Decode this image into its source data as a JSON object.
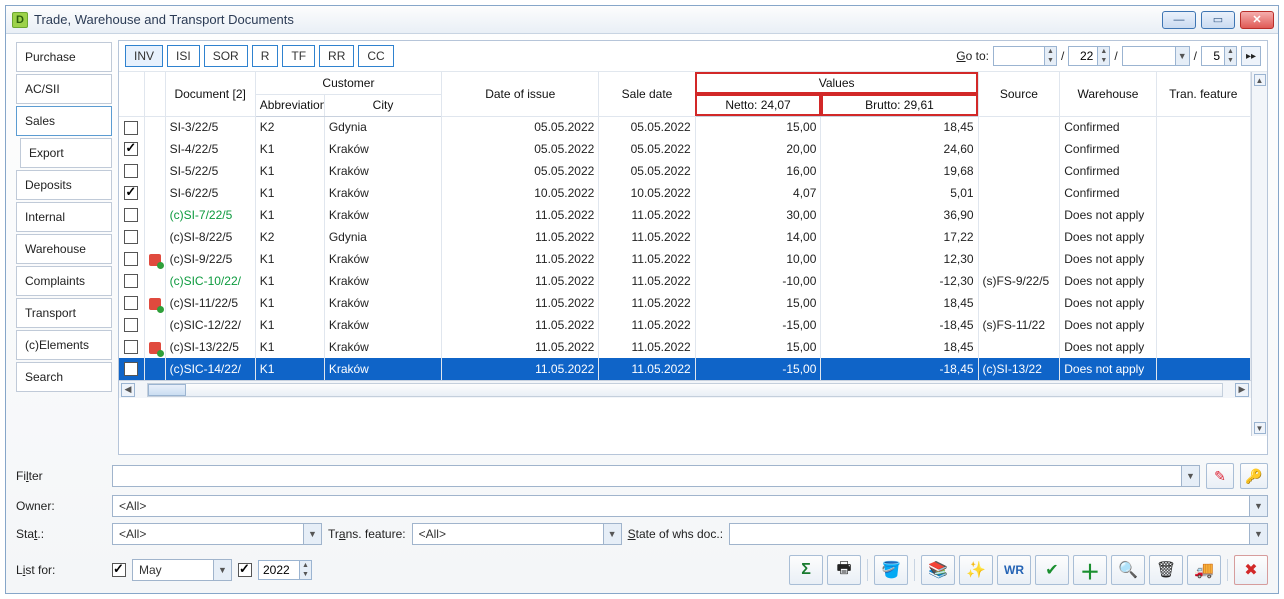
{
  "window": {
    "title": "Trade, Warehouse and Transport Documents"
  },
  "vtabs": {
    "purchase": "Purchase",
    "acsii": "AC/SII",
    "sales": "Sales",
    "export": "Export",
    "deposits": "Deposits",
    "internal": "Internal",
    "warehouse": "Warehouse",
    "complaints": "Complaints",
    "transport": "Transport",
    "celements": "(c)Elements",
    "search": "Search"
  },
  "doctabs": {
    "inv": "INV",
    "isi": "ISI",
    "sor": "SOR",
    "r": "R",
    "tf": "TF",
    "rr": "RR",
    "cc": "CC"
  },
  "goto": {
    "label": "Go to:",
    "val1": "",
    "slash": "/",
    "val2": "22",
    "val3": "",
    "val4": "5"
  },
  "grid": {
    "headers": {
      "document": "Document [2]",
      "customer": "Customer",
      "abbr": "Abbreviation",
      "city": "City",
      "dateissue": "Date of issue",
      "saledate": "Sale date",
      "values": "Values",
      "netto": "Netto: 24,07",
      "brutto": "Brutto: 29,61",
      "source": "Source",
      "warehouse": "Warehouse",
      "tranfeature": "Tran. feature"
    },
    "rows": [
      {
        "checked": false,
        "flag": "",
        "doc": "SI-3/22/5",
        "green": false,
        "abbr": "K2",
        "city": "Gdynia",
        "d1": "05.05.2022",
        "d2": "05.05.2022",
        "netto": "15,00",
        "brutto": "18,45",
        "src": "",
        "wh": "Confirmed",
        "tf": ""
      },
      {
        "checked": true,
        "flag": "",
        "doc": "SI-4/22/5",
        "green": false,
        "abbr": "K1",
        "city": "Kraków",
        "d1": "05.05.2022",
        "d2": "05.05.2022",
        "netto": "20,00",
        "brutto": "24,60",
        "src": "",
        "wh": "Confirmed",
        "tf": ""
      },
      {
        "checked": false,
        "flag": "",
        "doc": "SI-5/22/5",
        "green": false,
        "abbr": "K1",
        "city": "Kraków",
        "d1": "05.05.2022",
        "d2": "05.05.2022",
        "netto": "16,00",
        "brutto": "19,68",
        "src": "",
        "wh": "Confirmed",
        "tf": ""
      },
      {
        "checked": true,
        "flag": "",
        "doc": "SI-6/22/5",
        "green": false,
        "abbr": "K1",
        "city": "Kraków",
        "d1": "10.05.2022",
        "d2": "10.05.2022",
        "netto": "4,07",
        "brutto": "5,01",
        "src": "",
        "wh": "Confirmed",
        "tf": ""
      },
      {
        "checked": false,
        "flag": "",
        "doc": "(c)SI-7/22/5",
        "green": true,
        "abbr": "K1",
        "city": "Kraków",
        "d1": "11.05.2022",
        "d2": "11.05.2022",
        "netto": "30,00",
        "brutto": "36,90",
        "src": "",
        "wh": "Does not apply",
        "tf": ""
      },
      {
        "checked": false,
        "flag": "",
        "doc": "(c)SI-8/22/5",
        "green": false,
        "abbr": "K2",
        "city": "Gdynia",
        "d1": "11.05.2022",
        "d2": "11.05.2022",
        "netto": "14,00",
        "brutto": "17,22",
        "src": "",
        "wh": "Does not apply",
        "tf": ""
      },
      {
        "checked": false,
        "flag": "red",
        "doc": "(c)SI-9/22/5",
        "green": false,
        "abbr": "K1",
        "city": "Kraków",
        "d1": "11.05.2022",
        "d2": "11.05.2022",
        "netto": "10,00",
        "brutto": "12,30",
        "src": "",
        "wh": "Does not apply",
        "tf": ""
      },
      {
        "checked": false,
        "flag": "",
        "doc": "(c)SIC-10/22/",
        "green": true,
        "abbr": "K1",
        "city": "Kraków",
        "d1": "11.05.2022",
        "d2": "11.05.2022",
        "netto": "-10,00",
        "brutto": "-12,30",
        "src": "(s)FS-9/22/5",
        "wh": "Does not apply",
        "tf": ""
      },
      {
        "checked": false,
        "flag": "red",
        "doc": "(c)SI-11/22/5",
        "green": false,
        "abbr": "K1",
        "city": "Kraków",
        "d1": "11.05.2022",
        "d2": "11.05.2022",
        "netto": "15,00",
        "brutto": "18,45",
        "src": "",
        "wh": "Does not apply",
        "tf": ""
      },
      {
        "checked": false,
        "flag": "",
        "doc": "(c)SIC-12/22/",
        "green": false,
        "abbr": "K1",
        "city": "Kraków",
        "d1": "11.05.2022",
        "d2": "11.05.2022",
        "netto": "-15,00",
        "brutto": "-18,45",
        "src": "(s)FS-11/22",
        "wh": "Does not apply",
        "tf": ""
      },
      {
        "checked": false,
        "flag": "red",
        "doc": "(c)SI-13/22/5",
        "green": false,
        "abbr": "K1",
        "city": "Kraków",
        "d1": "11.05.2022",
        "d2": "11.05.2022",
        "netto": "15,00",
        "brutto": "18,45",
        "src": "",
        "wh": "Does not apply",
        "tf": ""
      },
      {
        "checked": false,
        "flag": "",
        "doc": "(c)SIC-14/22/",
        "green": false,
        "abbr": "K1",
        "city": "Kraków",
        "d1": "11.05.2022",
        "d2": "11.05.2022",
        "netto": "-15,00",
        "brutto": "-18,45",
        "src": "(c)SI-13/22",
        "wh": "Does not apply",
        "tf": "",
        "selected": true
      }
    ]
  },
  "filters": {
    "filter_label": "Filter",
    "filter_val": "",
    "owner_label": "Owner:",
    "owner_val": "<All>",
    "stat_label": "Stat.:",
    "stat_val": "<All>",
    "trans_label": "Trans. feature:",
    "trans_val": "<All>",
    "state_label": "State of whs doc.:",
    "state_val": "",
    "listfor_label": "List for:",
    "month": "May",
    "year": "2022"
  },
  "icons": {
    "sigma": "Σ",
    "printer": "🖶",
    "bucket": "🪣",
    "books": "📚",
    "wand": "✨",
    "wr": "WR",
    "check": "✔",
    "plus": "＋",
    "magnifier": "🔍",
    "trash": "🗑",
    "truck": "🚚",
    "close": "✖",
    "filterclear": "✎",
    "funnel": "🔑"
  }
}
